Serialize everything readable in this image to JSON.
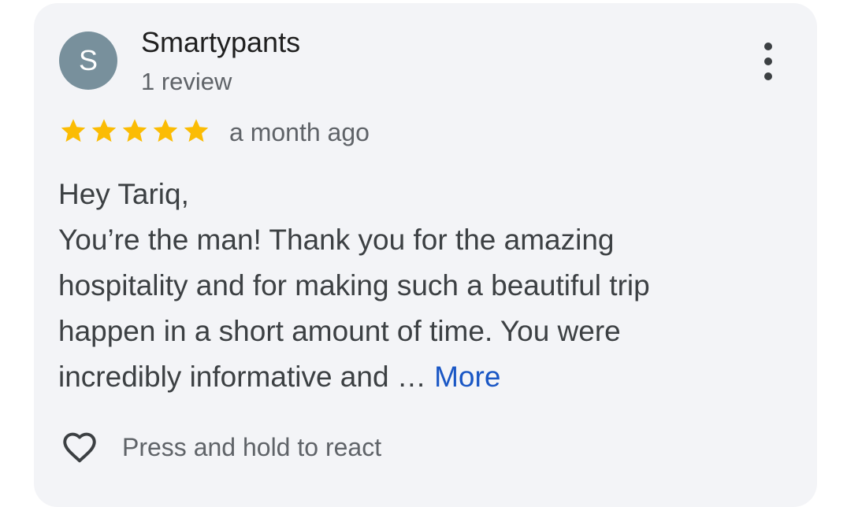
{
  "review": {
    "avatar_letter": "S",
    "author": "Smartypants",
    "review_count": "1 review",
    "rating": 5,
    "time_ago": "a month ago",
    "body_lines": [
      "Hey Tariq,",
      "You’re the man! Thank you for the amazing",
      "hospitality and for making such a beautiful trip",
      "happen in a short amount of time. You were"
    ],
    "last_line": "incredibly informative and … ",
    "more_label": "More",
    "react_label": "Press and hold to react"
  },
  "colors": {
    "card_background": "#f3f4f7",
    "avatar_background": "#78909c",
    "star": "#fbbc04",
    "link": "#1a57c5",
    "primary_text": "#1f1f1f",
    "secondary_text": "#5f6368"
  },
  "icons": {
    "menu": "more-vert-icon",
    "star": "star-icon",
    "react": "heart-outline-icon"
  }
}
